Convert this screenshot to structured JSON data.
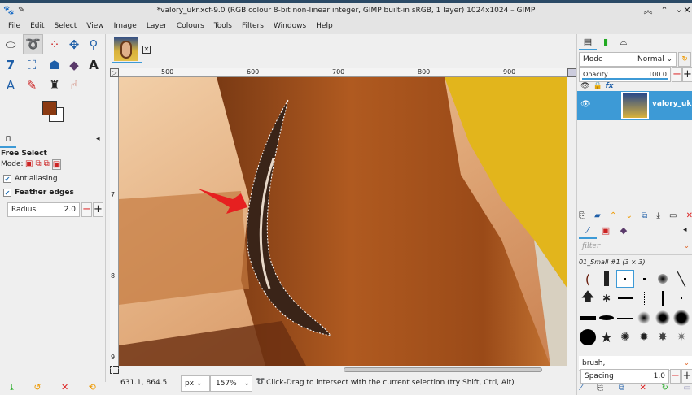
{
  "window": {
    "title": "*valory_ukr.xcf-9.0 (RGB colour 8-bit non-linear integer, GIMP built-in sRGB, 1 layer) 1024x1024 – GIMP"
  },
  "menu": [
    "File",
    "Edit",
    "Select",
    "View",
    "Image",
    "Layer",
    "Colours",
    "Tools",
    "Filters",
    "Windows",
    "Help"
  ],
  "colors": {
    "foreground": "#8b3a12",
    "background": "#ffffff",
    "accent": "#3d9ad6",
    "selected_layer": "#3d9ad6"
  },
  "tool_options": {
    "title": "Free Select",
    "mode_label": "Mode:",
    "antialiasing": {
      "label": "Antialiasing",
      "checked": true
    },
    "feather_edges": {
      "label": "Feather edges",
      "checked": true
    },
    "radius": {
      "label": "Radius",
      "value": "2.0"
    }
  },
  "rulers": {
    "h_ticks": [
      "500",
      "600",
      "700",
      "800",
      "900"
    ],
    "v_ticks": [
      "7",
      "8",
      "9"
    ]
  },
  "status": {
    "coords": "631.1, 864.5",
    "unit": "px",
    "zoom": "157%",
    "message": "Click-Drag to intersect with the current selection (try Shift, Ctrl, Alt)"
  },
  "layers": {
    "mode_label": "Mode",
    "mode_value": "Normal",
    "opacity_label": "Opacity",
    "opacity_value": "100.0",
    "opacity_percent": 100,
    "items": [
      {
        "name": "valory_ukr.png",
        "visible": true
      }
    ]
  },
  "brushes": {
    "filter_placeholder": "filter",
    "selected_name": "01_Small #1 (3 × 3)",
    "tag_value": "brush,",
    "spacing_label": "Spacing",
    "spacing_value": "1.0"
  }
}
